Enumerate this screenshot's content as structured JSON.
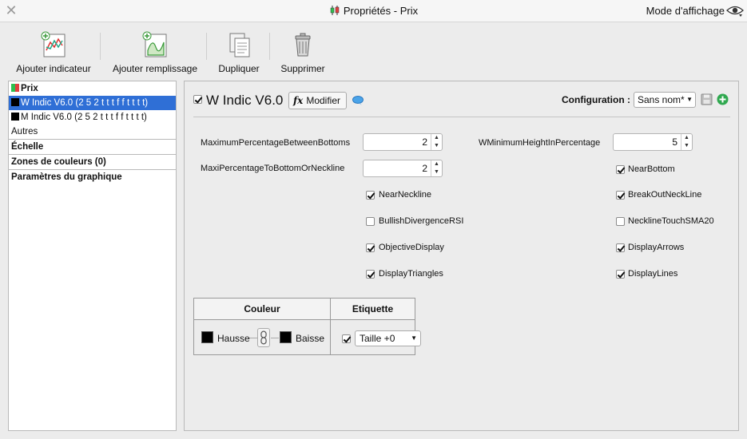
{
  "window": {
    "title": "Propriétés - Prix",
    "view_mode": "Mode d'affichage"
  },
  "toolbar": {
    "add_indicator": "Ajouter indicateur",
    "add_fill": "Ajouter remplissage",
    "duplicate": "Dupliquer",
    "delete": "Supprimer"
  },
  "tree": {
    "prix": "Prix",
    "w_indic": "W Indic V6.0 (2 5 2 t t t f f t t t t)",
    "m_indic": "M Indic V6.0 (2 5 2 t t t f f t t t t)",
    "autres": "Autres",
    "echelle": "Échelle",
    "zones": "Zones de couleurs (0)",
    "params": "Paramètres du graphique"
  },
  "panel": {
    "title": "W Indic V6.0",
    "enabled": true,
    "modify_label": "Modifier",
    "config_label": "Configuration :",
    "config_value": "Sans nom*"
  },
  "params": {
    "max_pct_bottoms": {
      "label": "MaximumPercentageBetweenBottoms",
      "value": "2"
    },
    "maxi_pct_neck": {
      "label": "MaxiPercentageToBottomOrNeckline",
      "value": "2"
    },
    "w_min_height": {
      "label": "WMinimumHeightInPercentage",
      "value": "5"
    }
  },
  "checks": {
    "near_bottom": {
      "label": "NearBottom",
      "checked": true
    },
    "near_neckline": {
      "label": "NearNeckline",
      "checked": true
    },
    "breakout_neckline": {
      "label": "BreakOutNeckLine",
      "checked": true
    },
    "bullish_div": {
      "label": "BullishDivergenceRSI",
      "checked": false
    },
    "neckline_touch": {
      "label": "NecklineTouchSMA20",
      "checked": false
    },
    "objective_display": {
      "label": "ObjectiveDisplay",
      "checked": true
    },
    "display_arrows": {
      "label": "DisplayArrows",
      "checked": true
    },
    "display_triangles": {
      "label": "DisplayTriangles",
      "checked": true
    },
    "display_lines": {
      "label": "DisplayLines",
      "checked": true
    }
  },
  "style": {
    "couleur_header": "Couleur",
    "etiquette_header": "Etiquette",
    "hausse": "Hausse",
    "baisse": "Baisse",
    "hausse_color": "#000000",
    "baisse_color": "#000000",
    "label_enabled": true,
    "taille": "Taille +0"
  },
  "colors": {
    "selection": "#2f6fd6",
    "add_green": "#2fa84f"
  }
}
